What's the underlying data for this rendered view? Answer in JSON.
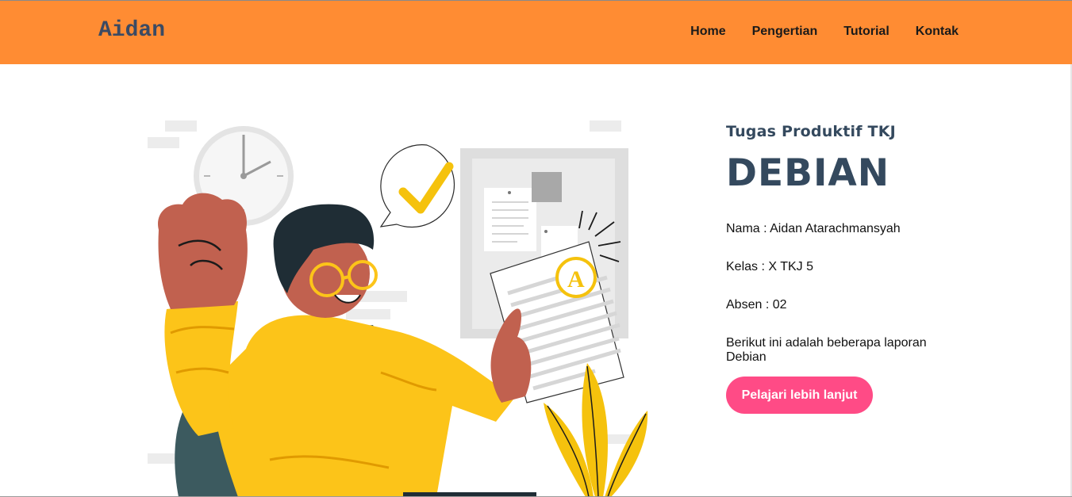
{
  "navbar": {
    "brand": "Aidan",
    "links": [
      "Home",
      "Pengertian",
      "Tutorial",
      "Kontak"
    ]
  },
  "hero": {
    "subtitle": "Tugas Produktif TKJ",
    "title": "DEBIAN",
    "nama": "Nama : Aidan Atarachmansyah",
    "kelas": "Kelas : X TKJ 5",
    "absen": "Absen : 02",
    "description": "Berikut ini adalah beberapa laporan Debian",
    "cta_label": "Pelajari lebih lanjut"
  },
  "illustration": {
    "icons": [
      "clock-icon",
      "checkmark-icon",
      "grade-a-icon"
    ]
  },
  "colors": {
    "navbar": "#ff8c33",
    "brand_text": "#3b4a63",
    "heading": "#34495e",
    "button": "#ff4b86",
    "shirt": "#fcc419",
    "skin": "#c1614f",
    "bag": "#3c5a5f"
  }
}
